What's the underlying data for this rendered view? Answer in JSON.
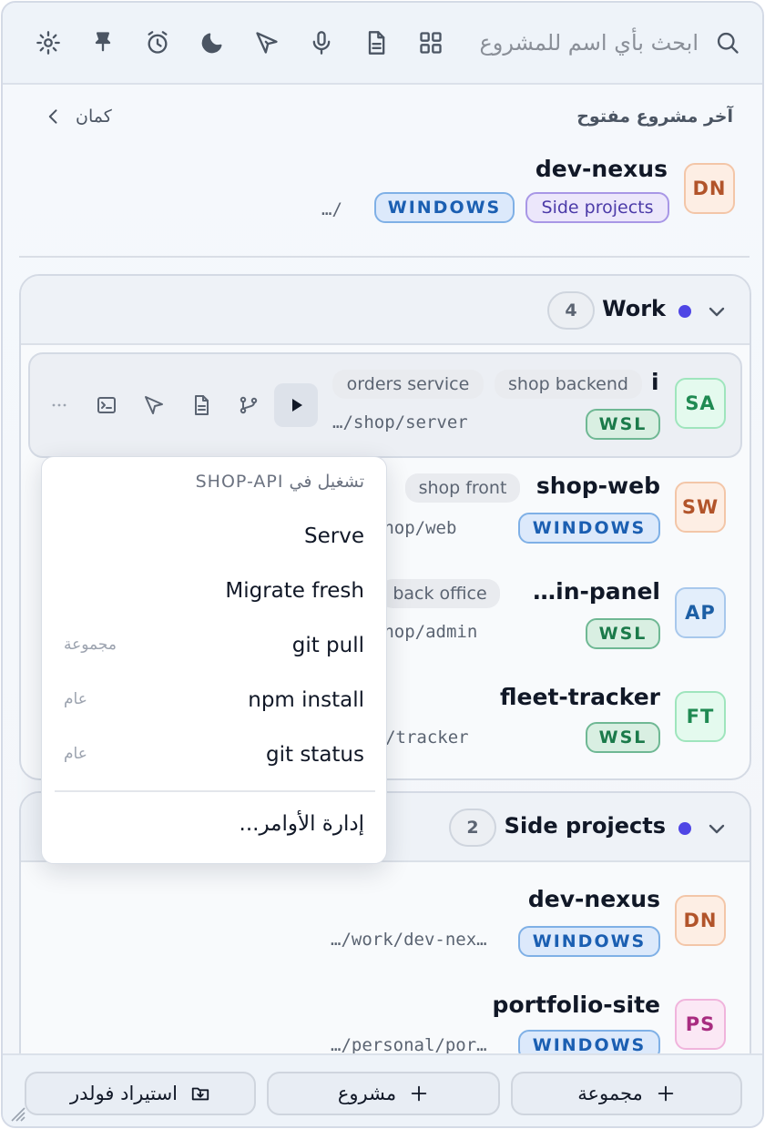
{
  "search": {
    "placeholder": "ابحث بأي اسم للمشروع"
  },
  "recent": {
    "title": "آخر مشروع مفتوح",
    "more_label": "كمان",
    "project": {
      "initials": "DN",
      "name": "dev-nexus",
      "group_badge": "Side projects",
      "os": "WINDOWS",
      "path": "…/"
    }
  },
  "groups": [
    {
      "name": "Work",
      "count": "4",
      "projects": [
        {
          "initials": "SA",
          "name": "i",
          "tags": [
            "shop backend",
            "orders service"
          ],
          "os": "WSL",
          "path": "…/shop/server"
        },
        {
          "initials": "SW",
          "name": "shop-web",
          "tags": [
            "shop front"
          ],
          "os": "WINDOWS",
          "path": "…/shop/web"
        },
        {
          "initials": "AP",
          "name": "…in-panel",
          "tags": [
            "back office"
          ],
          "os": "WSL",
          "path": "…/shop/admin"
        },
        {
          "initials": "FT",
          "name": "fleet-tracker",
          "tags": [],
          "os": "WSL",
          "path": "…/fleet/tracker"
        }
      ]
    },
    {
      "name": "Side projects",
      "count": "2",
      "projects": [
        {
          "initials": "DN",
          "name": "dev-nexus",
          "tags": [],
          "os": "WINDOWS",
          "path": "…/work/dev-nex…"
        },
        {
          "initials": "PS",
          "name": "portfolio-site",
          "tags": [],
          "os": "WINDOWS",
          "path": "…/personal/por…"
        }
      ]
    }
  ],
  "run_menu": {
    "header": "تشغيل في SHOP-API",
    "items": [
      {
        "label": "Serve",
        "hint": ""
      },
      {
        "label": "Migrate fresh",
        "hint": ""
      },
      {
        "label": "git pull",
        "hint": "مجموعة"
      },
      {
        "label": "npm install",
        "hint": "عام"
      },
      {
        "label": "git status",
        "hint": "عام"
      }
    ],
    "manage_label": "إدارة الأوامر..."
  },
  "footer": {
    "new_group": "مجموعة",
    "new_project": "مشروع",
    "import_folder": "استيراد فولدر"
  },
  "colors": {
    "accent": "#4f46e5",
    "windows_badge": "#1b5fb2",
    "wsl_badge": "#1b7a4a"
  },
  "icons": [
    "search-icon",
    "grid-icon",
    "document-icon",
    "mic-icon",
    "send-icon",
    "moon-icon",
    "alarm-icon",
    "pin-icon",
    "gear-icon",
    "chevron-left-icon",
    "chevron-down-icon",
    "play-icon",
    "git-branch-icon",
    "document-icon",
    "send-icon",
    "terminal-icon",
    "more-icon",
    "plus-icon",
    "folder-import-icon"
  ]
}
